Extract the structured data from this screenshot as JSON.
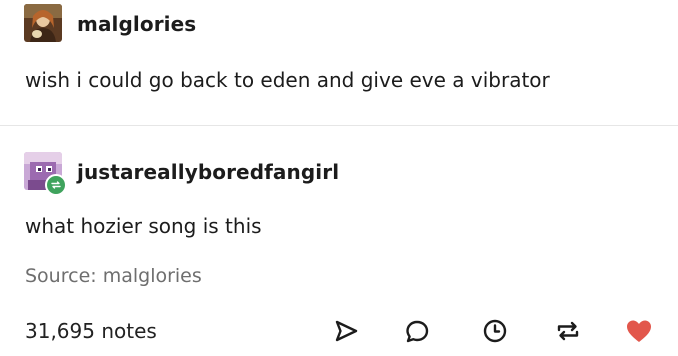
{
  "post": {
    "original": {
      "username": "malglories",
      "text": "wish i could go back to eden and give eve a vibrator"
    },
    "reply": {
      "username": "justareallyboredfangirl",
      "text": "what hozier song is this"
    },
    "source_text": "Source: malglories",
    "notes_count": "31,695 notes"
  },
  "icons": {
    "share": "share-icon",
    "reply": "reply-icon",
    "queue": "queue-clock-icon",
    "reblog": "reblog-icon",
    "like": "heart-icon"
  },
  "colors": {
    "text": "#1c1c1c",
    "muted": "#6e6e6e",
    "like": "#e2574c",
    "reblog_badge": "#3fa35d"
  }
}
